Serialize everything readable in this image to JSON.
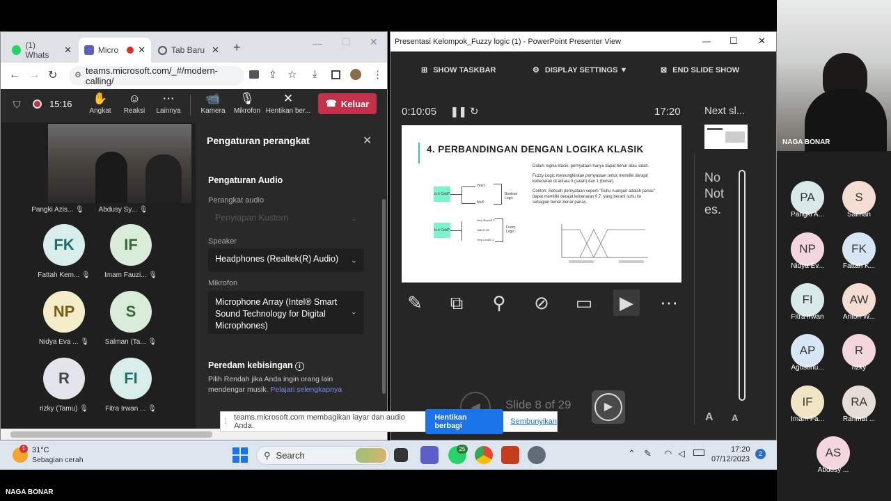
{
  "chrome": {
    "tabs": [
      {
        "label": "(1) Whats"
      },
      {
        "label": "Micro"
      },
      {
        "label": "Tab Baru"
      }
    ],
    "url": "teams.microsoft.com/_#/modern-calling/"
  },
  "teams": {
    "timer": "15:16",
    "toolbar": [
      {
        "label": "Angkat",
        "icon": "✋"
      },
      {
        "label": "Reaksi",
        "icon": "☺"
      },
      {
        "label": "Lainnya",
        "icon": "⋯"
      },
      {
        "label": "Kamera",
        "icon": "📹"
      },
      {
        "label": "Mikrofon",
        "icon": "🎙"
      },
      {
        "label": "Hentikan ber...",
        "icon": "✕"
      }
    ],
    "leave_label": "Keluar",
    "participants": [
      {
        "name": "Pangki Azis...",
        "initials": ""
      },
      {
        "name": "Abdusy Sy...",
        "initials": ""
      },
      {
        "name": "Fattah Kem...",
        "initials": "FK"
      },
      {
        "name": "Imam Fauzi...",
        "initials": "IF"
      },
      {
        "name": "Nidya Eva ...",
        "initials": "NP"
      },
      {
        "name": "Salman (Ta...",
        "initials": "S"
      },
      {
        "name": "rizky (Tamu)",
        "initials": "R"
      },
      {
        "name": "Fitra Irwan ...",
        "initials": "FI"
      }
    ],
    "settings": {
      "title": "Pengaturan perangkat",
      "audio_heading": "Pengaturan Audio",
      "audio_device_label": "Perangkat audio",
      "audio_device_value": "Penyiapan Kustom",
      "speaker_label": "Speaker",
      "speaker_value": "Headphones (Realtek(R) Audio)",
      "mic_label": "Mikrofon",
      "mic_value": "Microphone Array (Intel® Smart Sound Technology for Digital Microphones)",
      "noise_heading": "Peredam kebisingan",
      "noise_desc": "Pilih Rendah jika Anda ingin orang lain mendengar musik.",
      "noise_link": "Pelajari selengkapnya"
    }
  },
  "ppt": {
    "window_title": "Presentasi Kelompok_Fuzzy logic (1) - PowerPoint Presenter View",
    "show_taskbar": "SHOW TASKBAR",
    "display_settings": "DISPLAY SETTINGS ▼",
    "end_slide_show": "END SLIDE SHOW",
    "elapsed": "0:10:05",
    "clock": "17:20",
    "next_slide": "Next sl...",
    "notes": "No Not es.",
    "slide_counter": "Slide 8 of 29",
    "slide": {
      "title": "4. PERBANDINGAN DENGAN LOGIKA KLASIK",
      "p1": "Dalam logika klasik, pernyataan hanya dapat benar atau salah.",
      "p2": "Fuzzy Logic memungkinkan pernyataan untuk memiliki derajat kebenaran di antara 0 (salah) dan 1 (benar).",
      "p3": "Contoh: Sebuah pernyataan seperti \"Suhu ruangan adalah panas\" dapat memiliki derajat kebenaran 0,7, yang berarti suhu itu sebagian benar-benar panas.",
      "bool_label": "Boolean Logic",
      "fuzzy_label": "Fuzzy Logic",
      "bool_out1": "Yes/1",
      "bool_out2": "No/0",
      "fuzzy_out1": "Very Much/0.9",
      "fuzzy_out2": "Little/0.25",
      "fuzzy_out3": "Very Less/0.1",
      "input1": "Is it Cold?",
      "input2": "Is it Cold?"
    }
  },
  "share_bar": {
    "message": "teams.microsoft.com membagikan layar dan audio Anda.",
    "stop_label": "Hentikan berbagi",
    "hide_label": "Sembunyikan"
  },
  "taskbar": {
    "weather_temp": "31°C",
    "weather_desc": "Sebagian cerah",
    "search_label": "Search",
    "time": "17:20",
    "date": "07/12/2023",
    "badge_count": "25",
    "weather_badge": "1",
    "notif_count": "2"
  },
  "strip": {
    "top_name": "NAGA BONAR",
    "people": [
      {
        "initials": "PA",
        "name": "Pangki A...",
        "color": "#d9e9ea"
      },
      {
        "initials": "S",
        "name": "Salman",
        "color": "#f6ddd3"
      },
      {
        "initials": "NP",
        "name": "Nidya Ev...",
        "color": "#f4d6df"
      },
      {
        "initials": "FK",
        "name": "Fattah K...",
        "color": "#d7e6f4"
      },
      {
        "initials": "FI",
        "name": "Fitra Irwan",
        "color": "#d9e9ea"
      },
      {
        "initials": "AW",
        "name": "Anton W...",
        "color": "#f6ddd3"
      },
      {
        "initials": "AP",
        "name": "Agustinu...",
        "color": "#d7e6f4"
      },
      {
        "initials": "R",
        "name": "rizky",
        "color": "#f4d6df"
      },
      {
        "initials": "IF",
        "name": "Imam Fa...",
        "color": "#f1e6c4"
      },
      {
        "initials": "RA",
        "name": "Rahmat ...",
        "color": "#e5ddd6"
      },
      {
        "initials": "AS",
        "name": "Abdusy ...",
        "color": "#f4d6df"
      }
    ]
  },
  "bottom_name": "NAGA BONAR"
}
